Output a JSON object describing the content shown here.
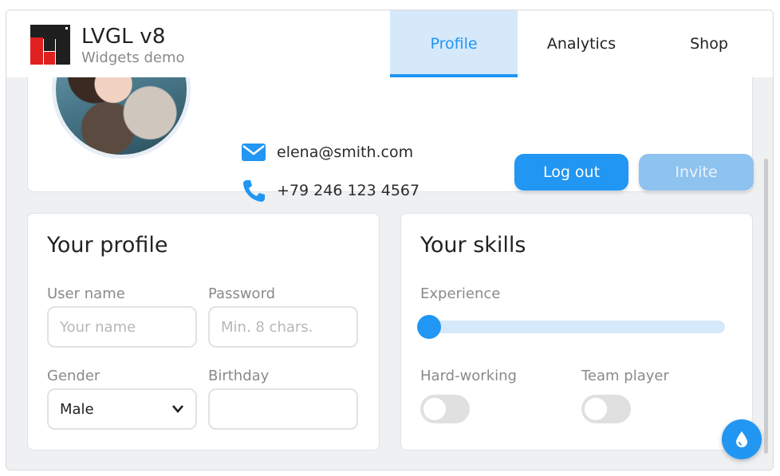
{
  "header": {
    "title": "LVGL v8",
    "subtitle": "Widgets demo",
    "logo_icon": "lvgl-logo-icon",
    "tabs": [
      {
        "label": "Profile",
        "active": true
      },
      {
        "label": "Analytics",
        "active": false
      },
      {
        "label": "Shop",
        "active": false
      }
    ]
  },
  "profile_card": {
    "email": "elena@smith.com",
    "phone": "+79 246 123 4567",
    "logout_label": "Log out",
    "invite_label": "Invite"
  },
  "your_profile": {
    "title": "Your profile",
    "username_label": "User name",
    "username_placeholder": "Your name",
    "password_label": "Password",
    "password_placeholder": "Min. 8 chars.",
    "gender_label": "Gender",
    "gender_value": "Male",
    "birthday_label": "Birthday",
    "birthday_value": ""
  },
  "your_skills": {
    "title": "Your skills",
    "experience_label": "Experience",
    "experience_value": 0,
    "hardworking_label": "Hard-working",
    "hardworking_on": false,
    "teamplayer_label": "Team player",
    "teamplayer_on": false
  },
  "colors": {
    "accent": "#2196f3",
    "accent_light": "#d6e9fb",
    "invite_disabled": "#8ec2ef"
  }
}
